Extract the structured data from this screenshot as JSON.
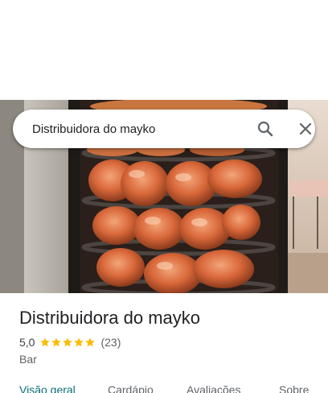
{
  "search": {
    "value": "Distribuidora do mayko"
  },
  "place": {
    "name": "Distribuidora do mayko",
    "rating": "5,0",
    "stars": 5,
    "reviews_count": "(23)",
    "category": "Bar"
  },
  "tabs": [
    {
      "label": "Visão geral",
      "active": true
    },
    {
      "label": "Cardápio"
    },
    {
      "label": "Avaliações"
    },
    {
      "label": "Sobre"
    }
  ],
  "colors": {
    "accent": "#0b6f75",
    "star": "#fbbc04",
    "text": "#202124",
    "muted": "#5f6368"
  },
  "icons": {
    "search": "search-icon",
    "close": "close-icon",
    "star": "star-icon"
  }
}
